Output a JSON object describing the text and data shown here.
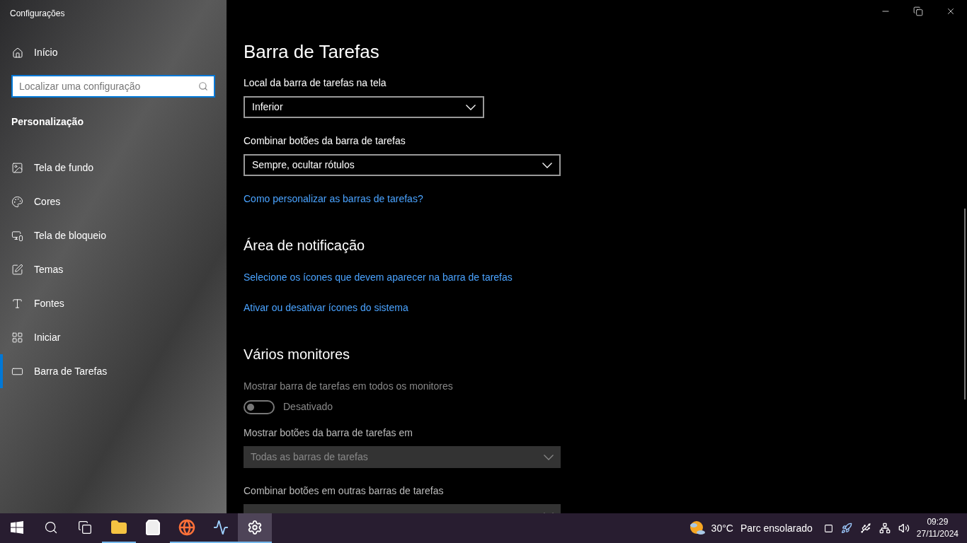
{
  "window": {
    "title": "Configurações"
  },
  "sidebar": {
    "home": "Início",
    "search": {
      "placeholder": "Localizar uma configuração"
    },
    "section": "Personalização",
    "items": [
      {
        "label": "Tela de fundo",
        "selected": false
      },
      {
        "label": "Cores",
        "selected": false
      },
      {
        "label": "Tela de bloqueio",
        "selected": false
      },
      {
        "label": "Temas",
        "selected": false
      },
      {
        "label": "Fontes",
        "selected": false
      },
      {
        "label": "Iniciar",
        "selected": false
      },
      {
        "label": "Barra de Tarefas",
        "selected": true
      }
    ]
  },
  "main": {
    "title": "Barra de Tarefas",
    "settings": [
      {
        "kind": "dropdown",
        "label": "Local da barra de tarefas na tela",
        "value": "Inferior",
        "disabled": false
      },
      {
        "kind": "dropdown",
        "label": "Combinar botões da barra de tarefas",
        "value": "Sempre, ocultar rótulos",
        "disabled": false
      },
      {
        "kind": "link",
        "label": "Como personalizar as barras de tarefas?"
      },
      {
        "kind": "heading",
        "label": "Área de notificação"
      },
      {
        "kind": "link",
        "label": "Selecione os ícones que devem aparecer na barra de tarefas"
      },
      {
        "kind": "link",
        "label": "Ativar ou desativar ícones do sistema"
      },
      {
        "kind": "heading",
        "label": "Vários monitores"
      },
      {
        "kind": "toggle",
        "label": "Mostrar barra de tarefas em todos os monitores",
        "on": false,
        "state_text": "Desativado",
        "disabled": true
      },
      {
        "kind": "dropdown",
        "label": "Mostrar botões da barra de tarefas em",
        "value": "Todas as barras de tarefas",
        "disabled": true
      },
      {
        "kind": "dropdown",
        "label": "Combinar botões em outras barras de tarefas",
        "disabled": true
      }
    ]
  },
  "taskbar": {
    "apps": [
      {
        "running": false,
        "selected": false
      },
      {
        "running": false,
        "selected": false
      },
      {
        "running": false,
        "selected": false
      },
      {
        "running": true,
        "selected": false
      },
      {
        "running": false,
        "selected": false
      },
      {
        "running": true,
        "selected": false
      },
      {
        "running": true,
        "selected": false
      },
      {
        "running": true,
        "selected": true
      }
    ],
    "weather": {
      "temperature": "30°C",
      "condition": "Parc ensolarado"
    },
    "time": "09:29",
    "date": "27/11/2024"
  }
}
